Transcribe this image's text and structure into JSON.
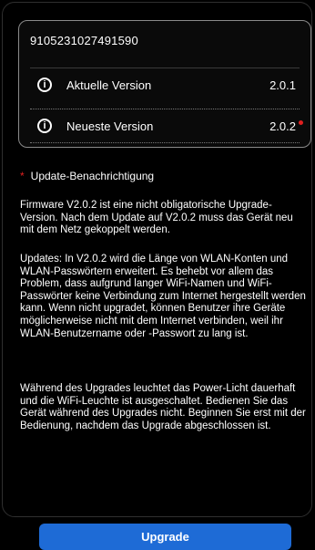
{
  "device": {
    "serial_number": "9105231027491590"
  },
  "versions": {
    "current_label": "Aktuelle Version",
    "current_value": "2.0.1",
    "latest_label": "Neueste Version",
    "latest_value": "2.0.2",
    "info_icon": "info-icon",
    "new_indicator_color": "#e02020"
  },
  "notification": {
    "title": "Update-Benachrichtigung",
    "paragraph_1": "Firmware V2.0.2 ist eine nicht obligatorische Upgrade-Version. Nach dem Update auf V2.0.2 muss das Gerät neu mit dem Netz gekoppelt werden.",
    "paragraph_2": "Updates: In V2.0.2 wird die Länge von WLAN-Konten und WLAN-Passwörtern erweitert. Es behebt vor allem das Problem, dass aufgrund langer WiFi-Namen und WiFi-Passwörter keine Verbindung zum Internet hergestellt werden kann. Wenn nicht upgradet, können Benutzer ihre Geräte möglicherweise nicht mit dem Internet verbinden, weil ihr WLAN-Benutzername oder -Passwort zu lang ist.",
    "paragraph_3": "Während des Upgrades leuchtet das Power-Licht dauerhaft und die WiFi-Leuchte ist ausgeschaltet. Bedienen Sie das Gerät während des Upgrades nicht. Beginnen Sie erst mit der Bedienung, nachdem das Upgrade abgeschlossen ist."
  },
  "actions": {
    "upgrade_label": "Upgrade",
    "accent_color": "#1e6bd6"
  }
}
